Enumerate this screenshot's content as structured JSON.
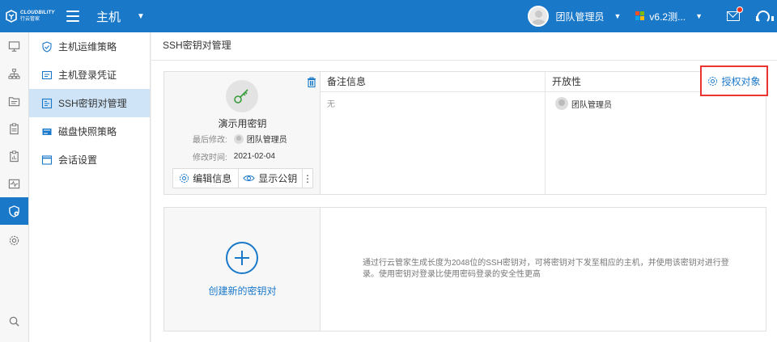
{
  "header": {
    "logo_line1": "CLOUDBILITY",
    "logo_line2": "行云管家",
    "module_title": "主机",
    "user_name": "团队管理员",
    "version_label": "v6.2测...",
    "brand_color": "#1a78c9"
  },
  "rail": {
    "items": [
      "monitor-icon",
      "topology-icon",
      "folder-icon",
      "clipboard-icon",
      "report-icon",
      "activity-icon",
      "shield-icon",
      "gear-icon",
      "search-icon"
    ],
    "active_index": 6
  },
  "subnav": {
    "items": [
      {
        "label": "主机运维策略",
        "icon": "shield-check-icon"
      },
      {
        "label": "主机登录凭证",
        "icon": "credential-icon"
      },
      {
        "label": "SSH密钥对管理",
        "icon": "keypair-icon"
      },
      {
        "label": "磁盘快照策略",
        "icon": "disk-icon"
      },
      {
        "label": "会话设置",
        "icon": "window-icon"
      }
    ],
    "active_index": 2
  },
  "page": {
    "title": "SSH密钥对管理"
  },
  "key_card": {
    "name": "演示用密钥",
    "modified_by_label": "最后修改:",
    "modified_by": "团队管理员",
    "modified_time_label": "修改时间:",
    "modified_time": "2021-02-04",
    "edit_label": "编辑信息",
    "show_pubkey_label": "显示公钥",
    "more_label": "⋮",
    "notes_header": "备注信息",
    "notes_value": "无",
    "openness_header": "开放性",
    "openness_value": "团队管理员",
    "auth_label": "授权对象"
  },
  "create_card": {
    "label": "创建新的密钥对",
    "description": "通过行云管家生成长度为2048位的SSH密钥对，可将密钥对下发至相应的主机，并使用该密钥对进行登录。使用密钥对登录比使用密码登录的安全性更高"
  }
}
